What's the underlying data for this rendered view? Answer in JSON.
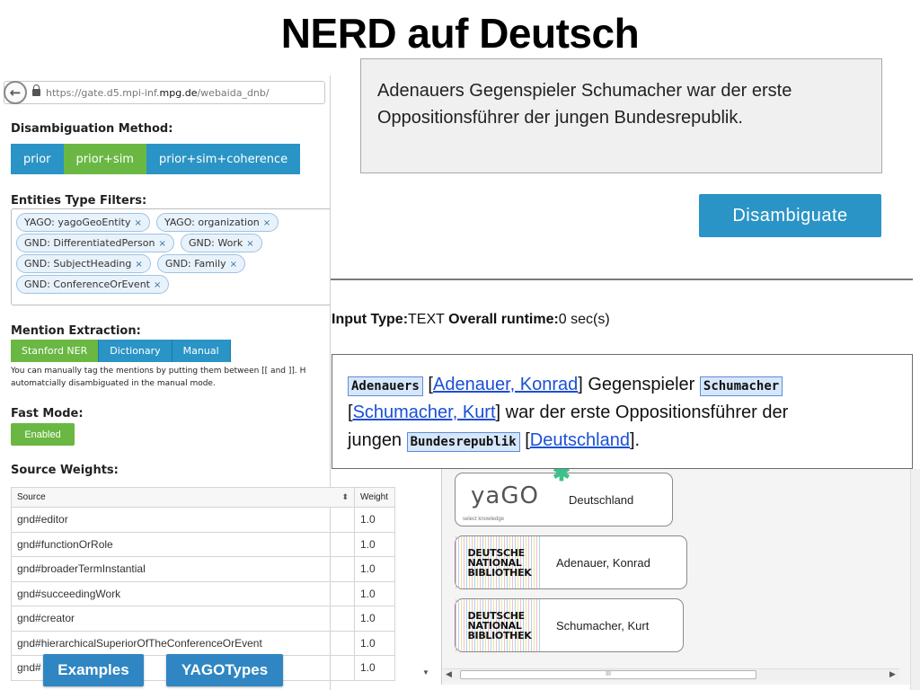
{
  "slide": {
    "title": "NERD auf Deutsch"
  },
  "browser": {
    "url_prefix": "https://gate.d5.mpi-inf.",
    "url_host": "mpg.de",
    "url_path": "/webaida_dnb/"
  },
  "disambiguation": {
    "heading": "Disambiguation Method:",
    "options": [
      "prior",
      "prior+sim",
      "prior+sim+coherence"
    ],
    "selected": "prior+sim"
  },
  "filters": {
    "heading": "Entities Type Filters:",
    "chips": [
      "YAGO: yagoGeoEntity",
      "YAGO: organization",
      "GND: DifferentiatedPerson",
      "GND: Work",
      "GND: SubjectHeading",
      "GND: Family",
      "GND: ConferenceOrEvent"
    ],
    "remove_glyph": "×"
  },
  "mention": {
    "heading": "Mention Extraction:",
    "options": [
      "Stanford NER",
      "Dictionary",
      "Manual"
    ],
    "selected": "Stanford NER",
    "note_line1": "You can manually tag the mentions by putting them between [[ and ]]. H",
    "note_line2": "automatcially disambiguated in the manual mode."
  },
  "fast_mode": {
    "heading": "Fast Mode:",
    "button": "Enabled"
  },
  "weights": {
    "heading": "Source Weights:",
    "columns": [
      "Source",
      "Weight"
    ],
    "sort_glyph": "⬍",
    "rows": [
      {
        "source": "gnd#editor",
        "weight": "1.0"
      },
      {
        "source": "gnd#functionOrRole",
        "weight": "1.0"
      },
      {
        "source": "gnd#broaderTermInstantial",
        "weight": "1.0"
      },
      {
        "source": "gnd#succeedingWork",
        "weight": "1.0"
      },
      {
        "source": "gnd#creator",
        "weight": "1.0"
      },
      {
        "source": "gnd#hierarchicalSuperiorOfTheConferenceOrEvent",
        "weight": "1.0"
      },
      {
        "source": "gnd#",
        "weight": "1.0"
      }
    ]
  },
  "overlay_buttons": {
    "examples": "Examples",
    "yagotypes": "YAGOTypes"
  },
  "input_text": "Adenauers Gegenspieler Schumacher war der erste Oppositionsführer der jungen Bundesrepublik.",
  "disambiguate_button": "Disambiguate",
  "runtime": {
    "input_type_label": "Input Type:",
    "input_type_value": "TEXT",
    "overall_label": "Overall runtime:",
    "overall_value": "0 sec(s)"
  },
  "result": {
    "m1": "Adenauers",
    "l1": "Adenauer, Konrad",
    "t1": "Gegenspieler",
    "m2": "Schumacher",
    "l2": "Schumacher, Kurt",
    "t2": "war der erste Oppositionsführer der",
    "t3": "jungen",
    "m3": "Bundesrepublik",
    "l3": "Deutschland",
    "t4": "."
  },
  "entities": [
    {
      "kb": "yago",
      "kb_text": "yaGO",
      "kb_sub": "select knowledge",
      "name": "Deutschland"
    },
    {
      "kb": "dnb",
      "kb_lines": [
        "DEUTSCHE",
        "NATIONAL",
        "BIBLIOTHEK"
      ],
      "name": "Adenauer, Konrad"
    },
    {
      "kb": "dnb",
      "kb_lines": [
        "DEUTSCHE",
        "NATIONAL",
        "BIBLIOTHEK"
      ],
      "name": "Schumacher, Kurt"
    }
  ],
  "scroll": {
    "thumb_glyph": "III"
  },
  "colors": {
    "blue": "#2b94c6",
    "green": "#6ab843",
    "mention_bg": "#d6e6fb",
    "link": "#1a4fd6"
  }
}
